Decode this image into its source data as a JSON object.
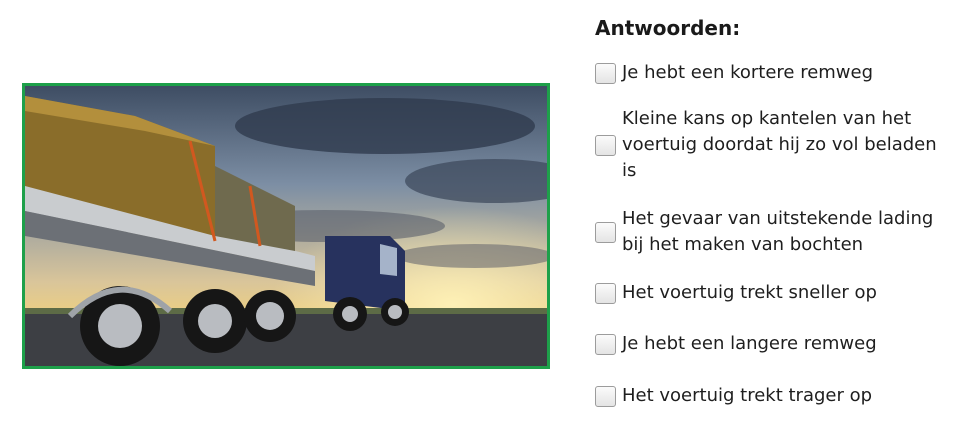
{
  "answers": {
    "title": "Antwoorden:",
    "options": [
      {
        "label": "Je hebt een kortere remweg",
        "checked": false
      },
      {
        "label": "Kleine kans op kantelen van het voertuig doordat hij zo vol beladen is",
        "checked": false
      },
      {
        "label": "Het gevaar van uitstekende lading bij het maken van bochten",
        "checked": false
      },
      {
        "label": "Het voertuig trekt sneller op",
        "checked": false
      },
      {
        "label": "Je hebt een langere remweg",
        "checked": false
      },
      {
        "label": "Het voertuig trekt trager op",
        "checked": false
      }
    ]
  },
  "colors": {
    "image_border": "#1ea04a"
  }
}
